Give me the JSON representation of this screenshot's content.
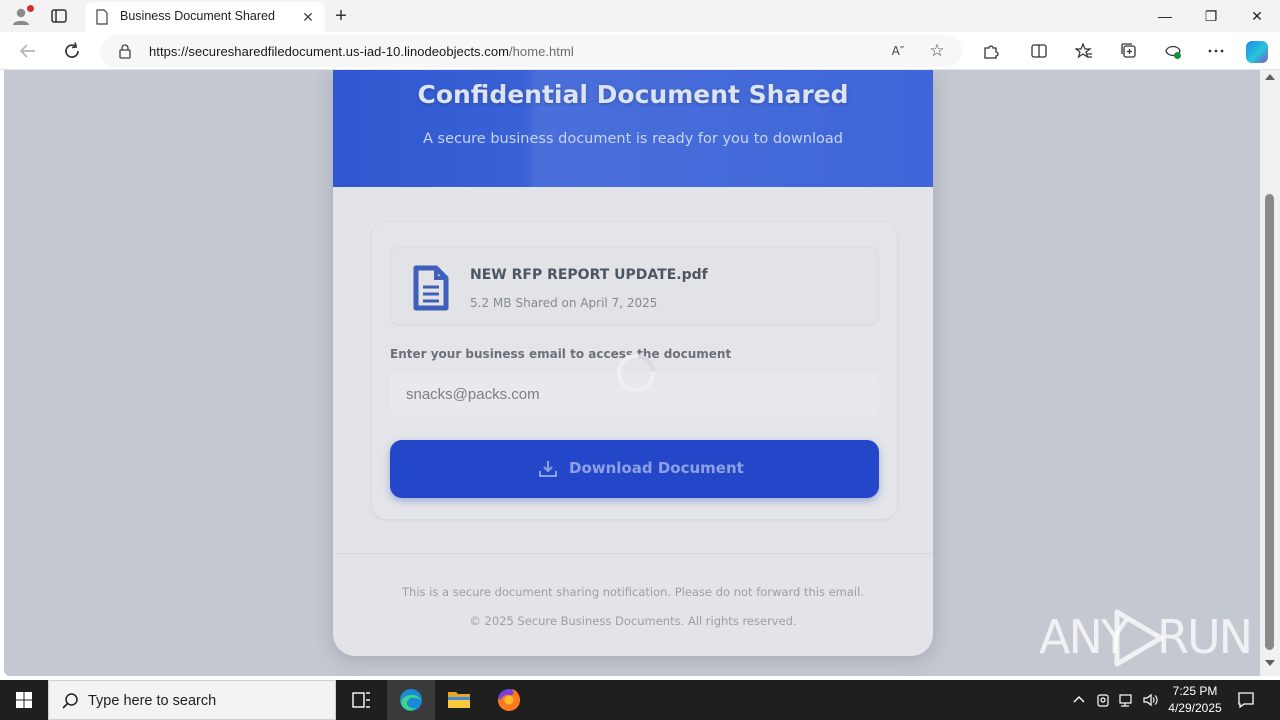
{
  "browser": {
    "tab_title": "Business Document Shared",
    "tab_close": "✕",
    "new_tab": "+",
    "url_host": "https://securesharedfiledocument.us-iad-10.linodeobjects.com",
    "url_path": "/home.html",
    "read_aloud": "A″",
    "favorite": "☆",
    "window_controls": {
      "minimize": "—",
      "maximize": "❐",
      "close": "✕"
    }
  },
  "page": {
    "banner_title": "Confidential Document Shared",
    "banner_subtitle": "A secure business document is ready for you to download",
    "file": {
      "name": "NEW RFP REPORT UPDATE.pdf",
      "size": "5.2 MB",
      "shared": "Shared on April 7, 2025"
    },
    "email_label": "Enter your business email to access the document",
    "email_value": "snacks@packs.com",
    "download_label": "Download Document",
    "footer_note": "This is a secure document sharing notification. Please do not forward this email.",
    "footer_copyright": "© 2025 Secure Business Documents. All rights reserved."
  },
  "watermark": {
    "left": "ANY",
    "right": "RUN"
  },
  "taskbar": {
    "search_placeholder": "Type here to search",
    "time": "7:25 PM",
    "date": "4/29/2025"
  },
  "colors": {
    "banner": "#3a64d8",
    "download_button": "#2447c9",
    "overlay": "#c4c8d0"
  }
}
